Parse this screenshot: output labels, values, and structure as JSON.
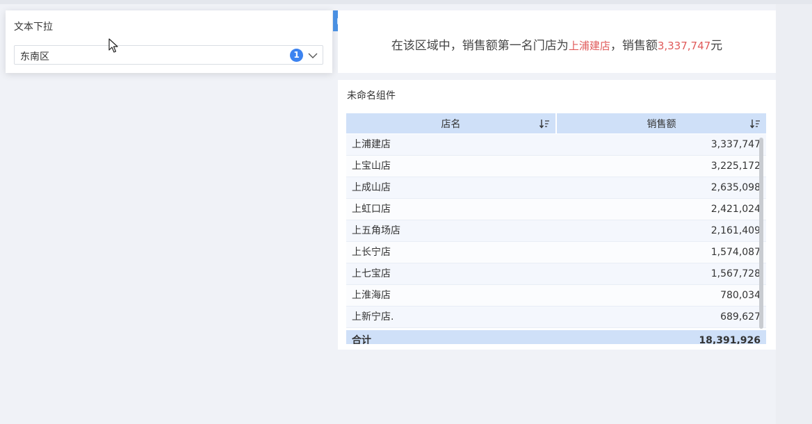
{
  "dropdown": {
    "title": "文本下拉",
    "selected": "东南区",
    "badge_count": "1"
  },
  "summary": {
    "prefix": "在该区域中，销售额第一名门店为",
    "top_store": "上浦建店",
    "middle": "，销售额",
    "top_sales": "3,337,747",
    "suffix": "元"
  },
  "table": {
    "title": "未命名组件",
    "columns": [
      "店名",
      "销售额"
    ],
    "rows": [
      {
        "name": "上浦建店",
        "sales": "3,337,747"
      },
      {
        "name": "上宝山店",
        "sales": "3,225,172"
      },
      {
        "name": "上成山店",
        "sales": "2,635,098"
      },
      {
        "name": "上虹口店",
        "sales": "2,421,024"
      },
      {
        "name": "上五角场店",
        "sales": "2,161,409"
      },
      {
        "name": "上长宁店",
        "sales": "1,574,087"
      },
      {
        "name": "上七宝店",
        "sales": "1,567,728"
      },
      {
        "name": "上淮海店",
        "sales": "780,034"
      },
      {
        "name": "上新宁店.",
        "sales": "689,627"
      }
    ],
    "total_label": "合计",
    "total_value": "18,391,926"
  },
  "icons": {
    "print": "print-icon",
    "sort": "sort-desc-icon",
    "chevron": "chevron-down-icon",
    "cursor": "mouse-cursor-icon"
  },
  "colors": {
    "accent": "#4a90e2",
    "badge": "#3c83f0",
    "highlight": "#e05a5a",
    "header_bg": "#cfe0f8"
  }
}
